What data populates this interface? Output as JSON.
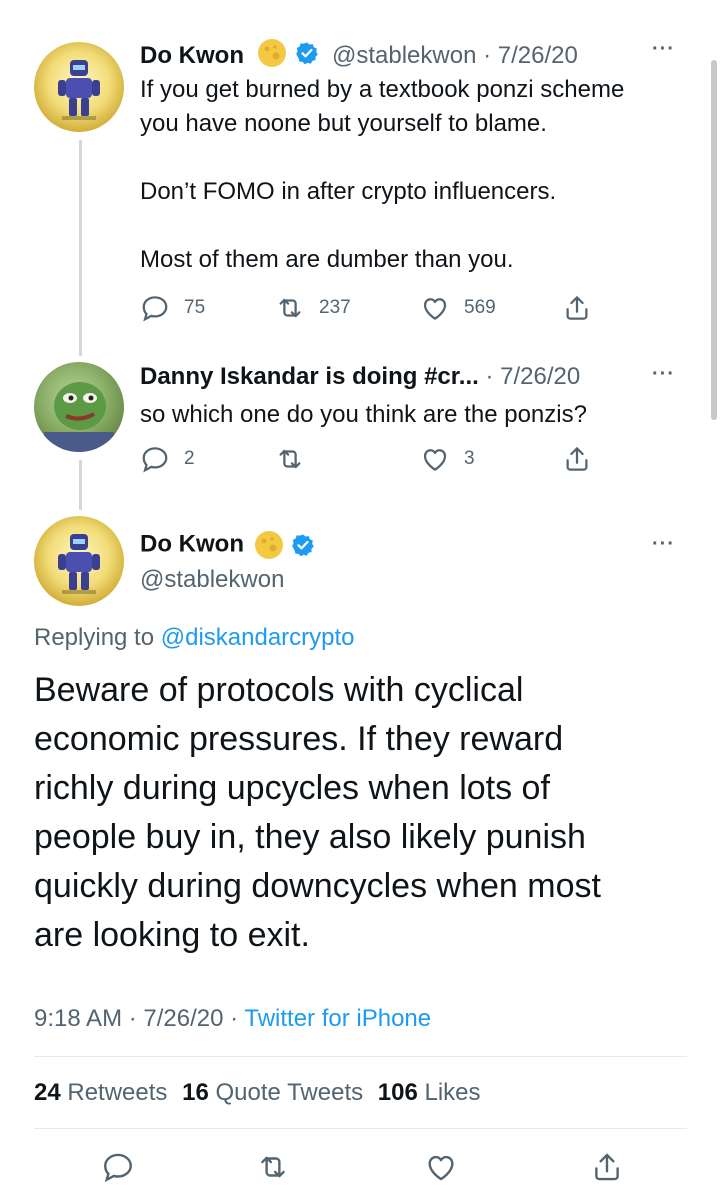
{
  "tweet1": {
    "name": "Do Kwon",
    "handle": "@stablekwon",
    "sep": " · ",
    "date": "7/26/20",
    "text": "If you get burned by a textbook ponzi scheme\nyou have noone but yourself to blame.\n\nDon’t FOMO in after crypto influencers.\n\nMost of them are dumber than you.",
    "replies": "75",
    "retweets": "237",
    "likes": "569"
  },
  "tweet2": {
    "name": "Danny Iskandar is doing #cr...",
    "sep": " · ",
    "date": "7/26/20",
    "text": "so which one do you think are the ponzis?",
    "replies": "2",
    "likes": "3"
  },
  "main_tweet": {
    "name": "Do Kwon",
    "handle": "@stablekwon",
    "replying_prefix": "Replying to ",
    "replying_handle": "@diskandarcrypto",
    "text": "Beware of protocols with cyclical\neconomic pressures. If they reward\nrichly during upcycles when lots of\npeople buy in, they also likely punish\nquickly during downcycles when most\nare looking to exit.",
    "time": "9:18 AM",
    "sep": " · ",
    "date": "7/26/20",
    "sep2": " · ",
    "source": "Twitter for iPhone",
    "retweets_count": "24",
    "retweets_label": " Retweets",
    "quotes_count": "16",
    "quotes_label": " Quote Tweets",
    "likes_count": "106",
    "likes_label": " Likes"
  },
  "icons": {
    "reply": "reply-icon",
    "retweet": "retweet-icon",
    "like": "heart-icon",
    "share": "share-icon",
    "verified": "verified-badge-icon",
    "moon": "moon-emoji-icon",
    "more": "more-icon"
  },
  "colors": {
    "accent": "#1d9bf0",
    "muted": "#536471",
    "text": "#0f1419",
    "line": "#cfd9de"
  }
}
